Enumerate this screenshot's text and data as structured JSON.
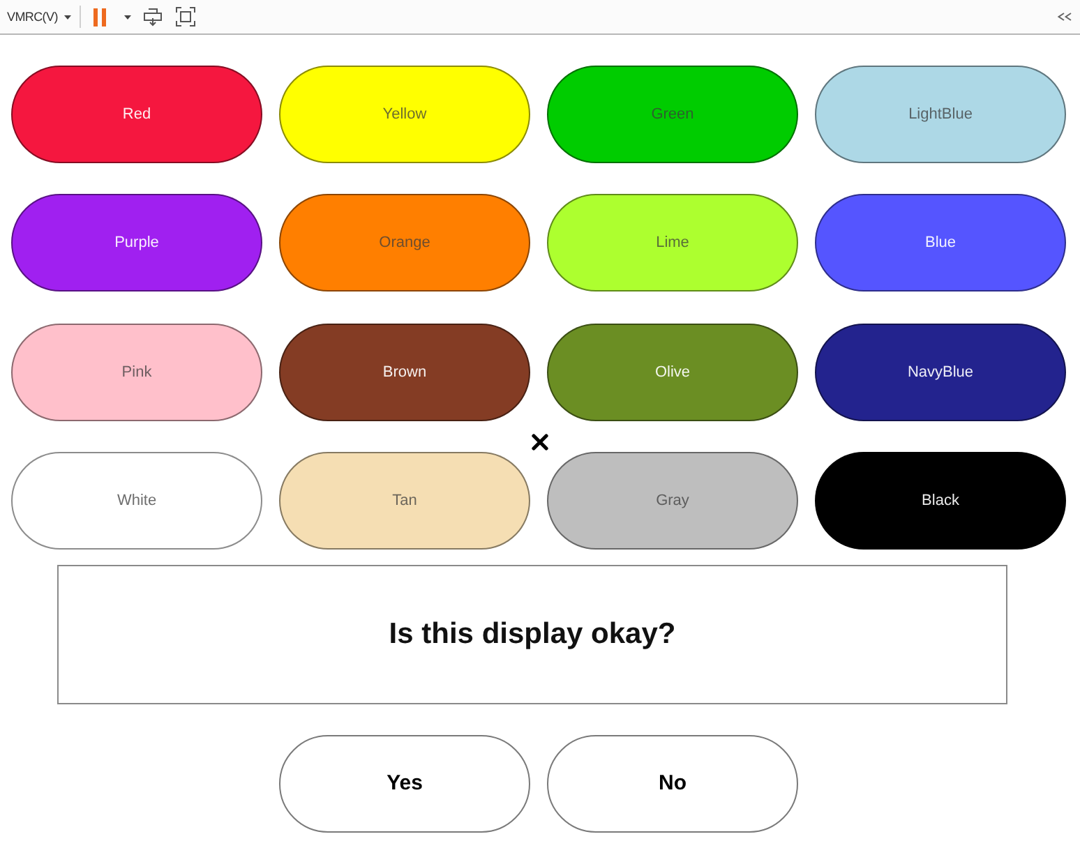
{
  "toolbar": {
    "menu_label": "VMRC(V)"
  },
  "color_buttons": [
    {
      "label": "Red",
      "color": "#f5173f"
    },
    {
      "label": "Yellow",
      "color": "#ffff00"
    },
    {
      "label": "Green",
      "color": "#00cc00"
    },
    {
      "label": "LightBlue",
      "color": "#add8e6"
    },
    {
      "label": "Purple",
      "color": "#a020f0"
    },
    {
      "label": "Orange",
      "color": "#ff7f00"
    },
    {
      "label": "Lime",
      "color": "#adff2f"
    },
    {
      "label": "Blue",
      "color": "#5555ff"
    },
    {
      "label": "Pink",
      "color": "#ffc0cb"
    },
    {
      "label": "Brown",
      "color": "#843c24"
    },
    {
      "label": "Olive",
      "color": "#6b8e23"
    },
    {
      "label": "NavyBlue",
      "color": "#23238e"
    },
    {
      "label": "White",
      "color": "#ffffff"
    },
    {
      "label": "Tan",
      "color": "#f5deb3"
    },
    {
      "label": "Gray",
      "color": "#bebebe"
    },
    {
      "label": "Black",
      "color": "#000000"
    }
  ],
  "prompt": {
    "text": "Is this display okay?"
  },
  "answer_buttons": [
    {
      "label": "Yes"
    },
    {
      "label": "No"
    }
  ]
}
